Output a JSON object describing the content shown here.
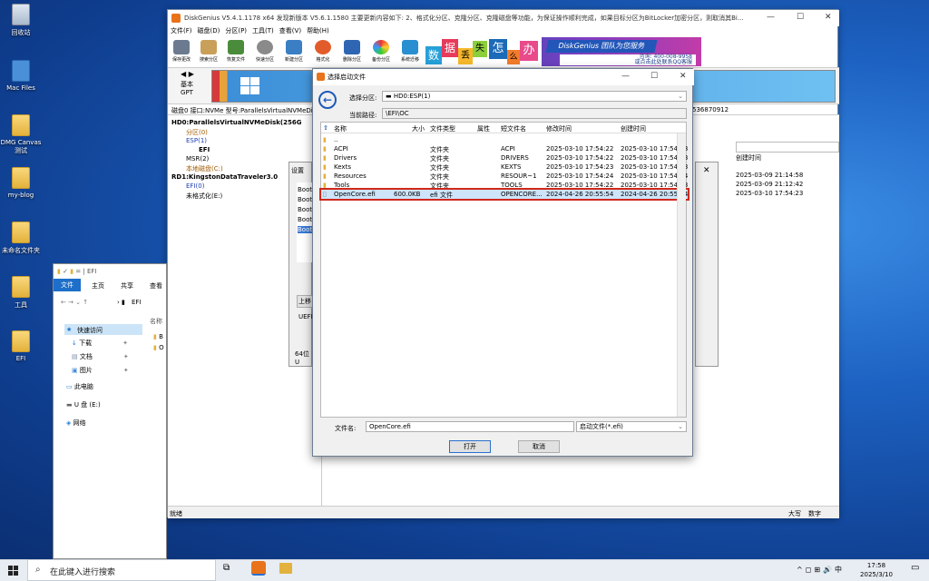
{
  "desktop": {
    "icons": [
      {
        "label": "回收站",
        "kind": "bin"
      },
      {
        "label": "Mac Files",
        "kind": "mac"
      },
      {
        "label": "DMG Canvas 测试",
        "kind": "doc"
      },
      {
        "label": "my-blog",
        "kind": "folder"
      },
      {
        "label": "未命名文件夹",
        "kind": "folder"
      },
      {
        "label": "工具",
        "kind": "folder"
      },
      {
        "label": "EFI",
        "kind": "folder"
      }
    ]
  },
  "taskbar": {
    "search_placeholder": "在此键入进行搜索",
    "time": "17:58",
    "date": "2025/3/10",
    "tray": [
      "^",
      "◻",
      "⊞",
      "🔊",
      "中"
    ]
  },
  "dg": {
    "title": "DiskGenius V5.4.1.1178 x64  发现新版本 V5.6.1.1580  主要更新内容如下: 2、格式化分区、克隆分区、克隆磁盘等功能，为保证操作顺利完成，如果目标分区为BitLocker加密分区，则取消其Bi...",
    "menu": [
      "文件(F)",
      "磁盘(D)",
      "分区(P)",
      "工具(T)",
      "查看(V)",
      "帮助(H)"
    ],
    "toolbar": [
      "保存更改",
      "搜索分区",
      "恢复文件",
      "快速分区",
      "新建分区",
      "格式化",
      "删除分区",
      "备份分区",
      "系统迁移"
    ],
    "banner": {
      "slogan": "DiskGenius 团队为您服务",
      "phone": "咨询: 400-008-9958",
      "qq": "或点击此处联系QQ客服",
      "chars": [
        "数",
        "据",
        "丢",
        "失",
        "怎",
        "么",
        "办"
      ]
    },
    "disk_label": "基本\nGPT",
    "disk_basic": "基本",
    "disk_gpt": "GPT",
    "disk_info": "磁盘0 接口:NVMe  型号:ParallelsVirtualNVMeDi",
    "disk_info_right": "536870912",
    "tree": [
      "HD0:ParallelsVirtualNVMeDisk(256G",
      "分区(0)",
      "ESP(1)",
      "EFI",
      "MSR(2)",
      "本地磁盘(C:)",
      "RD1:KingstonDataTraveler3.0",
      "EFI(0)",
      "未格式化(E:)"
    ],
    "right_header": "创建时间",
    "right_rows": [
      "2025-03-09 21:14:58",
      "2025-03-09 21:12:42",
      "2025-03-10 17:54:23"
    ],
    "status_left": "就绪",
    "status_right": [
      "大写",
      "数字"
    ]
  },
  "settings": {
    "title": "设置",
    "items": [
      "Boot",
      "Boot",
      "Boot",
      "Boot",
      "Boot"
    ],
    "btn": "上移",
    "uefi": "UEFI",
    "bits": "64位U"
  },
  "explorer": {
    "title": "EFI",
    "tabs": [
      "文件",
      "主页",
      "共享",
      "查看"
    ],
    "path": "EFI",
    "col": "名称",
    "nav": [
      "快速访问",
      "下载",
      "文档",
      "图片",
      "此电脑",
      "U 盘 (E:)",
      "网络"
    ],
    "files": [
      "B",
      "O"
    ]
  },
  "filedlg": {
    "title": "选择启动文件",
    "partition_label": "选择分区:",
    "partition_value": "HD0:ESP(1)",
    "path_label": "当前路径:",
    "path_value": "\\EFI\\OC",
    "columns": [
      "名称",
      "大小",
      "文件类型",
      "属性",
      "短文件名",
      "修改时间",
      "创建时间"
    ],
    "rows": [
      {
        "name": "..",
        "size": "",
        "type": "",
        "attr": "",
        "short": "",
        "mtime": "",
        "ctime": ""
      },
      {
        "name": "ACPI",
        "size": "",
        "type": "文件夹",
        "attr": "",
        "short": "ACPI",
        "mtime": "2025-03-10 17:54:22",
        "ctime": "2025-03-10 17:54:23"
      },
      {
        "name": "Drivers",
        "size": "",
        "type": "文件夹",
        "attr": "",
        "short": "DRIVERS",
        "mtime": "2025-03-10 17:54:22",
        "ctime": "2025-03-10 17:54:23"
      },
      {
        "name": "Kexts",
        "size": "",
        "type": "文件夹",
        "attr": "",
        "short": "KEXTS",
        "mtime": "2025-03-10 17:54:23",
        "ctime": "2025-03-10 17:54:23"
      },
      {
        "name": "Resources",
        "size": "",
        "type": "文件夹",
        "attr": "",
        "short": "RESOUR~1",
        "mtime": "2025-03-10 17:54:24",
        "ctime": "2025-03-10 17:54:24"
      },
      {
        "name": "Tools",
        "size": "",
        "type": "文件夹",
        "attr": "",
        "short": "TOOLS",
        "mtime": "2025-03-10 17:54:22",
        "ctime": "2025-03-10 17:54:23"
      },
      {
        "name": "OpenCore.efi",
        "size": "600.0KB",
        "type": "efi 文件",
        "attr": "",
        "short": "OPENCORE...",
        "mtime": "2024-04-26 20:55:54",
        "ctime": "2024-04-26 20:55:54"
      }
    ],
    "filename_label": "文件名:",
    "filename_value": "OpenCore.efi",
    "filter_value": "启动文件(*.efi)",
    "open_label": "打开",
    "cancel_label": "取消",
    "highlight_color": "#d0281c"
  }
}
